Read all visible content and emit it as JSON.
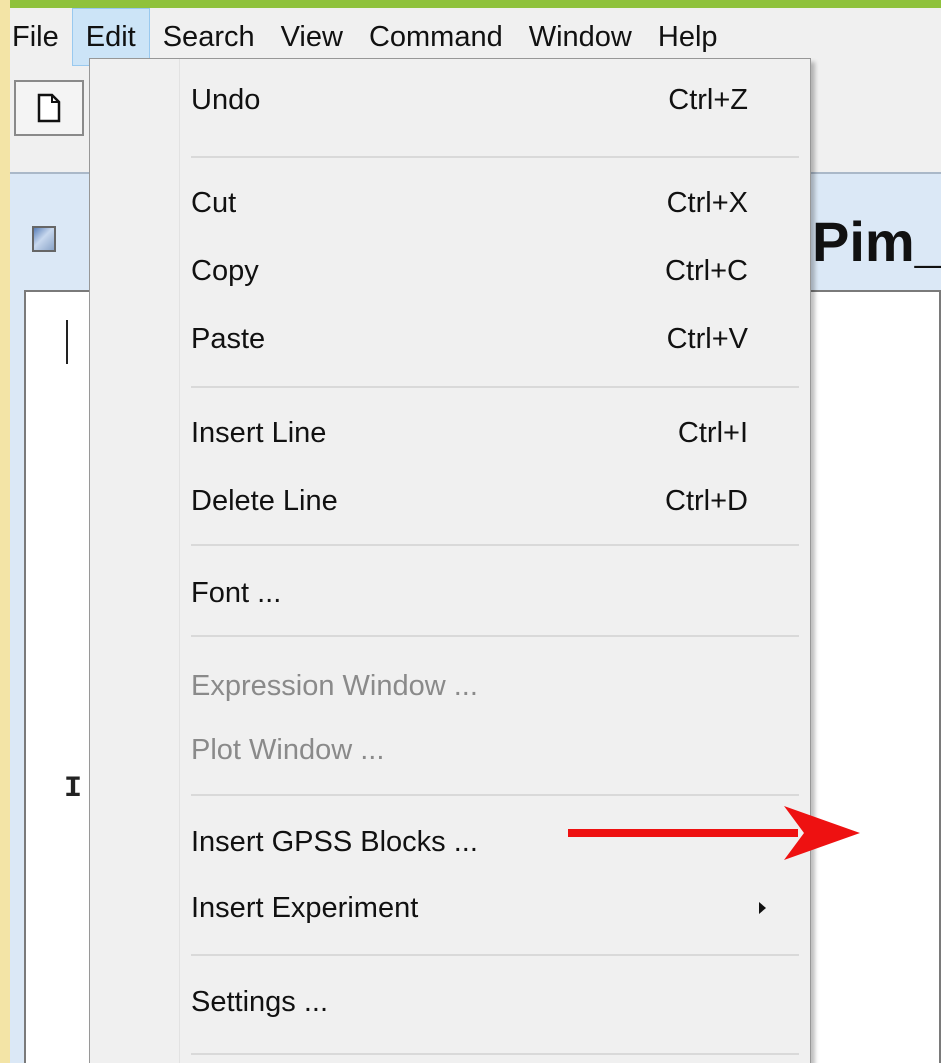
{
  "menubar": {
    "items": [
      {
        "label": "File"
      },
      {
        "label": "Edit"
      },
      {
        "label": "Search"
      },
      {
        "label": "View"
      },
      {
        "label": "Command"
      },
      {
        "label": "Window"
      },
      {
        "label": "Help"
      }
    ],
    "active": "Edit"
  },
  "document": {
    "title": "Pim_",
    "behind_text": "I"
  },
  "edit_menu": {
    "undo": {
      "label": "Undo",
      "shortcut": "Ctrl+Z"
    },
    "cut": {
      "label": "Cut",
      "shortcut": "Ctrl+X"
    },
    "copy": {
      "label": "Copy",
      "shortcut": "Ctrl+C"
    },
    "paste": {
      "label": "Paste",
      "shortcut": "Ctrl+V"
    },
    "insert_line": {
      "label": "Insert Line",
      "shortcut": "Ctrl+I"
    },
    "delete_line": {
      "label": "Delete Line",
      "shortcut": "Ctrl+D"
    },
    "font": {
      "label": "Font ..."
    },
    "expression_window": {
      "label": "Expression Window ..."
    },
    "plot_window": {
      "label": "Plot Window ..."
    },
    "insert_gpss_blocks": {
      "label": "Insert GPSS Blocks ..."
    },
    "insert_experiment": {
      "label": "Insert Experiment"
    },
    "settings": {
      "label": "Settings ..."
    }
  },
  "colors": {
    "menu_highlight": "#cce4f7",
    "annotation_arrow": "#ee1111",
    "disabled_text": "#8a8a8a"
  }
}
